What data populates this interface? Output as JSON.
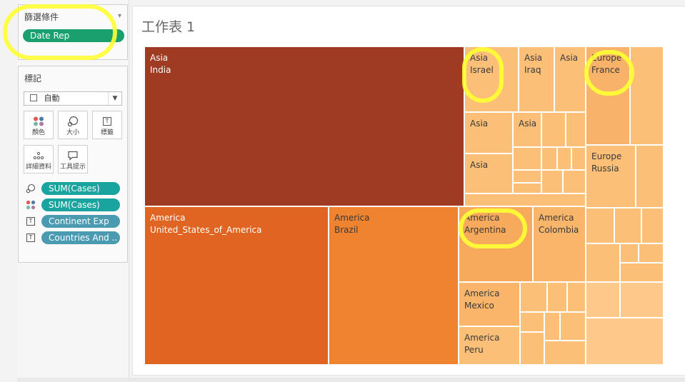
{
  "filters": {
    "title": "篩選條件",
    "pill": "Date Rep"
  },
  "marks": {
    "title": "標記",
    "type_value": "自動",
    "tiles": {
      "color": "顏色",
      "size": "大小",
      "label": "標籤",
      "detail": "詳細資料",
      "tooltip": "工具提示"
    },
    "fields": [
      {
        "label": "SUM(Cases)",
        "icon": "size-icon"
      },
      {
        "label": "SUM(Cases)",
        "icon": "color-icon"
      },
      {
        "label": "Continent Exp",
        "icon": "label-icon"
      },
      {
        "label": "Countries And ..",
        "icon": "label-icon"
      }
    ]
  },
  "sheet": {
    "title": "工作表 1"
  },
  "treemap": {
    "cells": [
      {
        "continent": "Asia",
        "country": "India"
      },
      {
        "continent": "Asia",
        "country": "Israel"
      },
      {
        "continent": "Asia",
        "country": "Iraq"
      },
      {
        "continent": "Asia",
        "country": ""
      },
      {
        "continent": "Asia",
        "country": ""
      },
      {
        "continent": "Asia",
        "country": ""
      },
      {
        "continent": "Asia",
        "country": ""
      },
      {
        "continent": "Europe",
        "country": "France"
      },
      {
        "continent": "Europe",
        "country": "Russia"
      },
      {
        "continent": "America",
        "country": "United_States_of_America"
      },
      {
        "continent": "America",
        "country": "Brazil"
      },
      {
        "continent": "America",
        "country": "Argentina"
      },
      {
        "continent": "America",
        "country": "Colombia"
      },
      {
        "continent": "America",
        "country": "Mexico"
      },
      {
        "continent": "America",
        "country": "Peru"
      }
    ]
  },
  "colors": {
    "india": "#9e3b22",
    "usa": "#e06522",
    "brazil": "#ef8330",
    "orange_mid": "#f7a95c",
    "peach": "#fbbf78",
    "peach_light": "#fcc98a",
    "highlight": "#ffff33"
  }
}
